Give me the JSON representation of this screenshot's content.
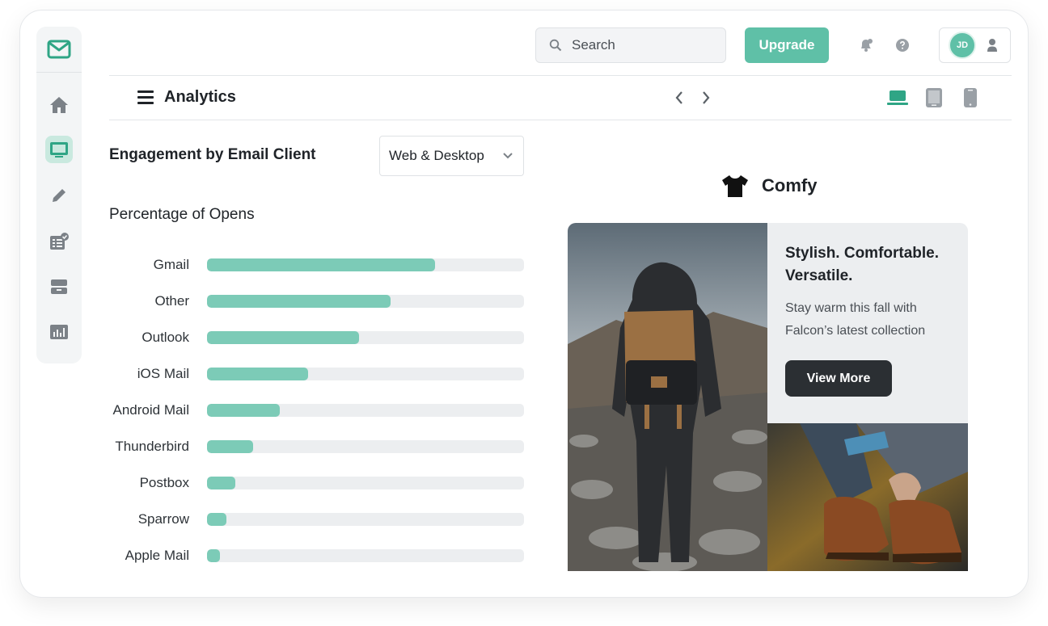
{
  "colors": {
    "accent": "#5fc0a7",
    "bar_fill": "#7ccbb7",
    "bar_track": "#eceef0",
    "dark": "#2b2f33"
  },
  "sidebar": {
    "logo_icon": "envelope-check-icon",
    "items": [
      {
        "icon": "home-icon",
        "active": false
      },
      {
        "icon": "inbox-icon",
        "active": true
      },
      {
        "icon": "pencil-icon",
        "active": false
      },
      {
        "icon": "checklist-icon",
        "active": false
      },
      {
        "icon": "archive-icon",
        "active": false
      },
      {
        "icon": "analytics-icon",
        "active": false
      }
    ]
  },
  "header": {
    "search": {
      "placeholder": "Search",
      "value": ""
    },
    "upgrade_label": "Upgrade",
    "notification_icon": "bell-icon",
    "help_icon": "question-icon",
    "avatar_initials": "JD",
    "user_icon": "user-icon"
  },
  "toolbar": {
    "title": "Analytics",
    "prev_icon": "chevron-left-icon",
    "next_icon": "chevron-right-icon",
    "devices": [
      {
        "icon": "laptop-icon",
        "active": true
      },
      {
        "icon": "tablet-icon",
        "active": false
      },
      {
        "icon": "phone-icon",
        "active": false
      }
    ]
  },
  "engagement": {
    "title": "Engagement by Email Client",
    "filter_value": "Web & Desktop",
    "subtitle": "Percentage of Opens"
  },
  "chart_data": {
    "type": "bar",
    "orientation": "horizontal",
    "title": "Percentage of Opens",
    "categories": [
      "Gmail",
      "Other",
      "Outlook",
      "iOS Mail",
      "Android Mail",
      "Thunderbird",
      "Postbox",
      "Sparrow",
      "Apple Mail"
    ],
    "values": [
      72,
      58,
      48,
      32,
      23,
      14.5,
      9,
      6,
      4
    ],
    "xlim": [
      0,
      100
    ],
    "grid": false,
    "legend": "none"
  },
  "preview": {
    "brand_name": "Comfy",
    "brand_icon": "tshirt-icon",
    "headline": "Stylish. Comfortable. Versatile.",
    "body": "Stay warm this fall with Falcon’s latest collection",
    "cta_label": "View More",
    "hero_image": "hiker-with-backpack-photo",
    "secondary_image": "lacing-boots-photo"
  }
}
